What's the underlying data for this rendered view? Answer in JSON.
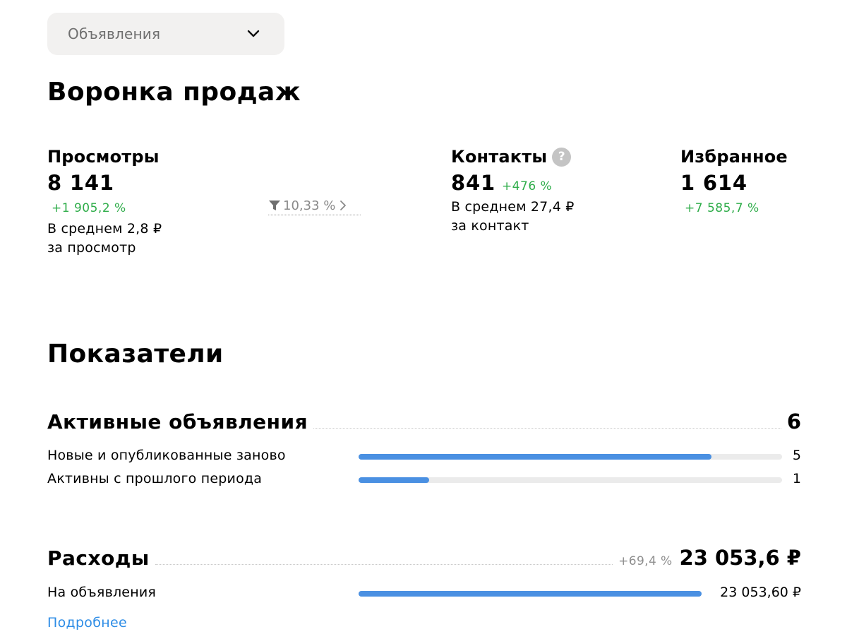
{
  "filter": {
    "selected": "Объявления"
  },
  "funnel": {
    "title": "Воронка продаж",
    "views": {
      "label": "Просмотры",
      "value": "8 141",
      "delta": "+1 905,2 %",
      "avg_line1": "В среднем 2,8 ₽",
      "avg_line2": "за просмотр"
    },
    "conversion": {
      "value": "10,33 %"
    },
    "contacts": {
      "label": "Контакты",
      "help": "?",
      "value": "841",
      "delta": "+476 %",
      "avg_line1": "В среднем 27,4 ₽",
      "avg_line2": "за контакт"
    },
    "favorites": {
      "label": "Избранное",
      "value": "1 614",
      "delta": "+7 585,7 %"
    }
  },
  "indicators": {
    "title": "Показатели",
    "active": {
      "title": "Активные объявления",
      "total": "6",
      "rows": [
        {
          "label": "Новые и опубликованные заново",
          "value": "5",
          "fraction": 0.833
        },
        {
          "label": "Активны с прошлого периода",
          "value": "1",
          "fraction": 0.167
        }
      ]
    },
    "expenses": {
      "title": "Расходы",
      "delta": "+69,4 %",
      "total": "23 053,6 ₽",
      "rows": [
        {
          "label": "На объявления",
          "value": "23 053,60 ₽",
          "fraction": 1.0
        }
      ]
    },
    "more_link": "Подробнее"
  },
  "colors": {
    "accent": "#4a90e2",
    "positive": "#2fad4a",
    "link": "#2e8de6",
    "track": "#ebebeb"
  },
  "icons": {
    "dropdown": "chevron-down-icon",
    "funnel": "funnel-icon",
    "arrow": "chevron-right-icon",
    "help": "question-icon"
  }
}
